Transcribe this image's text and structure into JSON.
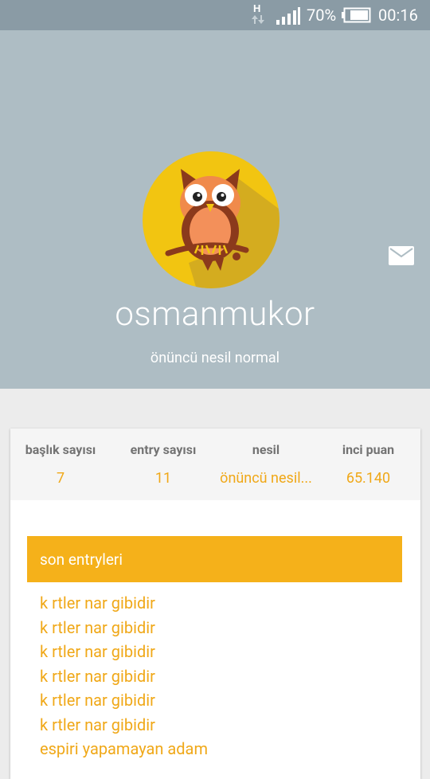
{
  "status_bar": {
    "network": "H",
    "battery_percent": "70%",
    "time": "00:16"
  },
  "profile": {
    "username": "osmanmukor",
    "title": "önüncü nesil normal",
    "avatar_icon": "owl-avatar-icon",
    "message_icon": "mail-icon"
  },
  "stats": [
    {
      "label": "başlık sayısı",
      "value": "7"
    },
    {
      "label": "entry sayısı",
      "value": "11"
    },
    {
      "label": "nesil",
      "value": "önüncü nesil..."
    },
    {
      "label": "inci puan",
      "value": "65.140"
    }
  ],
  "recent_entries": {
    "title": "son entryleri",
    "items": [
      "k rtler nar gibidir",
      "k rtler nar gibidir",
      "k rtler nar gibidir",
      "k rtler nar gibidir",
      "k rtler nar gibidir",
      "k rtler nar gibidir",
      "espiri yapamayan adam"
    ]
  },
  "colors": {
    "header_bg": "#aebdc4",
    "status_bar_bg": "#8a9ba5",
    "accent": "#f5b11a",
    "link": "#f0a818",
    "avatar_bg": "#f2c511"
  }
}
